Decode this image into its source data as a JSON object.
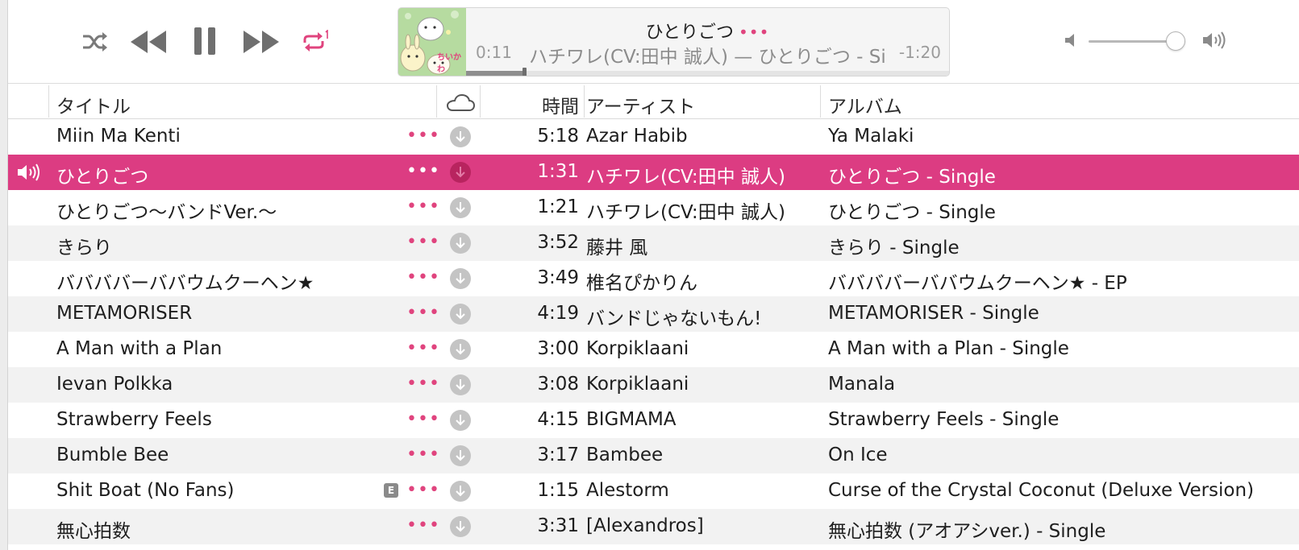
{
  "colors": {
    "accent": "#dc3c82",
    "dots": "#e0447e",
    "icon_grey": "#8a8a8a"
  },
  "controls": {
    "shuffle_icon": "shuffle-icon",
    "prev_icon": "rewind-icon",
    "pause_icon": "pause-icon",
    "next_icon": "fast-forward-icon",
    "repeat_icon": "repeat-one-icon"
  },
  "now_playing": {
    "title": "ひとりごつ",
    "more": "•••",
    "subtitle": "ハチワレ(CV:田中 誠人) — ひとりごつ - Single",
    "elapsed": "0:11",
    "remaining": "-1:20",
    "progress": 0.12,
    "artwork_text": "ちいかわ"
  },
  "volume": {
    "level": 0.9
  },
  "headers": {
    "title": "タイトル",
    "time": "時間",
    "artist": "アーティスト",
    "album": "アルバム"
  },
  "tracks": [
    {
      "title": "Miin Ma Kenti",
      "time": "5:18",
      "artist": "Azar Habib",
      "album": "Ya Malaki",
      "more": "•••",
      "explicit": "",
      "playing": false
    },
    {
      "title": "ひとりごつ",
      "time": "1:31",
      "artist": "ハチワレ(CV:田中 誠人)",
      "album": "ひとりごつ - Single",
      "more": "•••",
      "explicit": "",
      "playing": true
    },
    {
      "title": "ひとりごつ〜バンドVer.〜",
      "time": "1:21",
      "artist": "ハチワレ(CV:田中 誠人)",
      "album": "ひとりごつ - Single",
      "more": "•••",
      "explicit": "",
      "playing": false
    },
    {
      "title": "きらり",
      "time": "3:52",
      "artist": "藤井 風",
      "album": "きらり - Single",
      "more": "•••",
      "explicit": "",
      "playing": false
    },
    {
      "title": "ババババーババウムクーヘン★",
      "time": "3:49",
      "artist": "椎名ぴかりん",
      "album": "ババババーババウムクーヘン★ - EP",
      "more": "•••",
      "explicit": "",
      "playing": false
    },
    {
      "title": "METAMORISER",
      "time": "4:19",
      "artist": "バンドじゃないもん!",
      "album": "METAMORISER - Single",
      "more": "•••",
      "explicit": "",
      "playing": false
    },
    {
      "title": "A Man with a Plan",
      "time": "3:00",
      "artist": "Korpiklaani",
      "album": "A Man with a Plan - Single",
      "more": "•••",
      "explicit": "",
      "playing": false
    },
    {
      "title": "Ievan Polkka",
      "time": "3:08",
      "artist": "Korpiklaani",
      "album": "Manala",
      "more": "•••",
      "explicit": "",
      "playing": false
    },
    {
      "title": "Strawberry Feels",
      "time": "4:15",
      "artist": "BIGMAMA",
      "album": "Strawberry Feels - Single",
      "more": "•••",
      "explicit": "",
      "playing": false
    },
    {
      "title": "Bumble Bee",
      "time": "3:17",
      "artist": "Bambee",
      "album": "On Ice",
      "more": "•••",
      "explicit": "",
      "playing": false
    },
    {
      "title": "Shit Boat (No Fans)",
      "time": "1:15",
      "artist": "Alestorm",
      "album": "Curse of the Crystal Coconut (Deluxe Version)",
      "more": "•••",
      "explicit": "E",
      "playing": false
    },
    {
      "title": "無心拍数",
      "time": "3:31",
      "artist": "[Alexandros]",
      "album": "無心拍数 (アオアシver.) - Single",
      "more": "•••",
      "explicit": "",
      "playing": false
    }
  ]
}
